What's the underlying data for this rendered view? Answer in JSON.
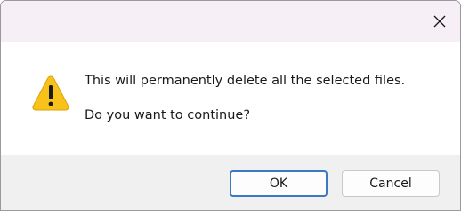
{
  "dialog": {
    "message": "This will permanently delete all the selected files.",
    "question": "Do you want to continue?",
    "icon": "warning-icon",
    "ok_label": "OK",
    "cancel_label": "Cancel",
    "close_icon": "close-icon"
  },
  "colors": {
    "titlebar": "#f7eff6",
    "footer": "#f0f0f0",
    "warning_fill": "#f8c21a",
    "default_button_border": "#3b79c2"
  }
}
